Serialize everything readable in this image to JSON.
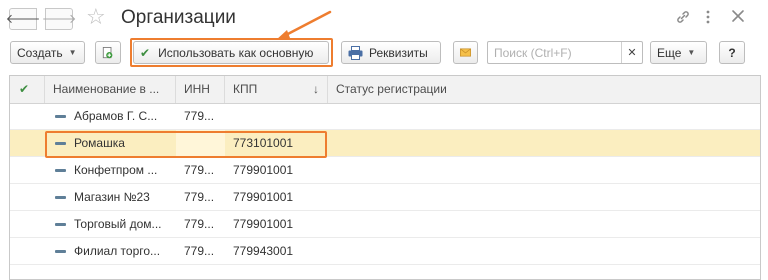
{
  "window": {
    "title": "Организации",
    "back_icon": "arrow-left-icon",
    "forward_icon": "arrow-right-icon",
    "favorite_icon": "star-icon",
    "link_icon": "link-icon",
    "menu_icon": "more-vertical-icon",
    "close_icon": "close-icon"
  },
  "toolbar": {
    "create_label": "Создать",
    "use_main_label": "Использовать как основную",
    "requisites_label": "Реквизиты",
    "search_placeholder": "Поиск (Ctrl+F)",
    "search_value": "",
    "more_label": "Еще",
    "help_label": "?"
  },
  "table": {
    "columns": {
      "check": "✔",
      "name": "Наименование в ...",
      "inn": "ИНН",
      "kpp": "КПП",
      "status": "Статус регистрации"
    },
    "sort_indicator": "↓",
    "rows": [
      {
        "name": "Абрамов Г. С...",
        "inn": "779...",
        "kpp": "",
        "status": "",
        "selected": false
      },
      {
        "name": "Ромашка",
        "inn": "",
        "kpp": "773101001",
        "status": "",
        "selected": true
      },
      {
        "name": "Конфетпром ...",
        "inn": "779...",
        "kpp": "779901001",
        "status": "",
        "selected": false
      },
      {
        "name": "Магазин №23",
        "inn": "779...",
        "kpp": "779901001",
        "status": "",
        "selected": false
      },
      {
        "name": "Торговый дом...",
        "inn": "779...",
        "kpp": "779901001",
        "status": "",
        "selected": false
      },
      {
        "name": "Филиал торго...",
        "inn": "779...",
        "kpp": "779943001",
        "status": "",
        "selected": false
      }
    ]
  },
  "colors": {
    "highlight": "#ee7d2f",
    "selected_row": "#fbeec0",
    "check_green": "#3e8e41"
  }
}
